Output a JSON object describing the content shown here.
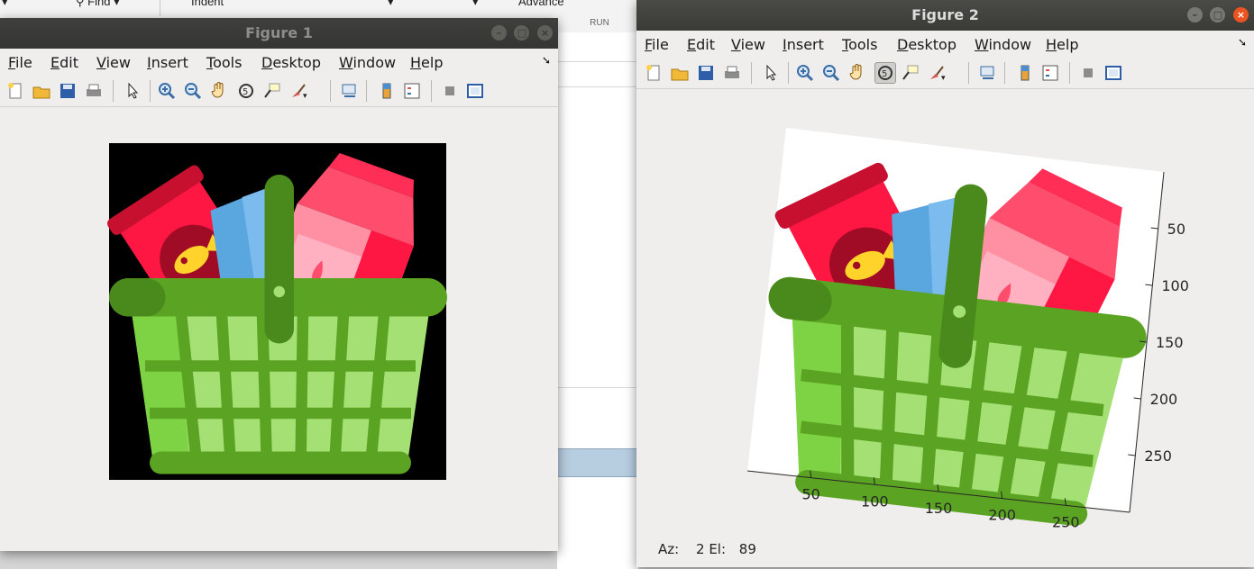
{
  "background": {
    "toolstrip": {
      "find_label": "Find",
      "indent_label": "Indent",
      "advance_label": "Advance"
    },
    "run_label": "RUN"
  },
  "figure1": {
    "title": "Figure 1",
    "menu": [
      "File",
      "Edit",
      "View",
      "Insert",
      "Tools",
      "Desktop",
      "Window",
      "Help"
    ]
  },
  "figure2": {
    "title": "Figure 2",
    "menu": [
      "File",
      "Edit",
      "View",
      "Insert",
      "Tools",
      "Desktop",
      "Window",
      "Help"
    ],
    "status": {
      "az_label": "Az:",
      "az_value": "2",
      "el_label": "El:",
      "el_value": "89"
    }
  },
  "chart_data": {
    "type": "image",
    "title": "",
    "view": {
      "azimuth": 2,
      "elevation": 89
    },
    "x_ticks": [
      50,
      100,
      150,
      200,
      250
    ],
    "y_ticks": [
      50,
      100,
      150,
      200,
      250
    ],
    "y_axis_side": "right"
  },
  "icons": [
    "new-figure-icon",
    "open-icon",
    "save-icon",
    "print-icon",
    "pointer-icon",
    "zoom-in-icon",
    "zoom-out-icon",
    "pan-icon",
    "rotate-3d-icon",
    "data-cursor-icon",
    "brush-icon",
    "link-icon",
    "colorbar-icon",
    "legend-icon",
    "hide-plot-tools-icon",
    "show-plot-tools-icon"
  ],
  "colors": {
    "basket_dark": "#5ba322",
    "basket_light": "#a4e074",
    "handle": "#4a8a1c",
    "red": "#ff1744",
    "pink": "#ff8fa3",
    "blue": "#5aa7e0",
    "fish": "#ffd32a"
  }
}
